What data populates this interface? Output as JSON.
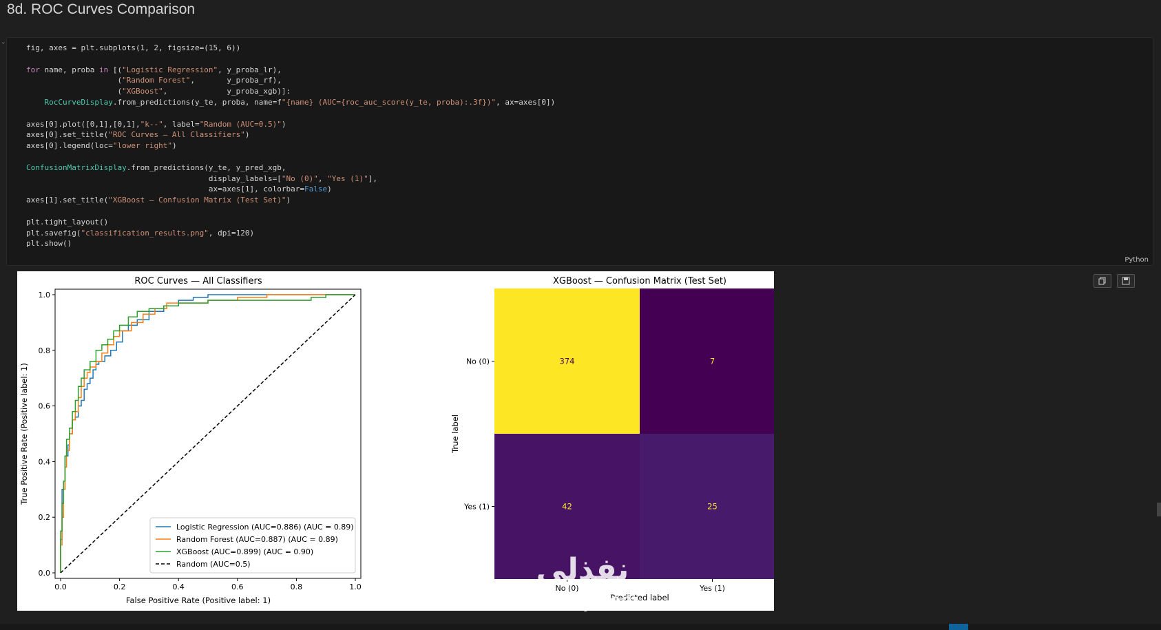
{
  "heading": "8d. ROC Curves Comparison",
  "cell": {
    "language": "Python",
    "code_lines": [
      "fig, axes = plt.subplots(1, 2, figsize=(15, 6))",
      "",
      "for name, proba in [(\"Logistic Regression\", y_proba_lr),",
      "                    (\"Random Forest\",       y_proba_rf),",
      "                    (\"XGBoost\",             y_proba_xgb)]:",
      "    RocCurveDisplay.from_predictions(y_te, proba, name=f\"{name} (AUC={roc_auc_score(y_te, proba):.3f})\", ax=axes[0])",
      "",
      "axes[0].plot([0,1],[0,1],\"k--\", label=\"Random (AUC=0.5)\")",
      "axes[0].set_title(\"ROC Curves — All Classifiers\")",
      "axes[0].legend(loc=\"lower right\")",
      "",
      "ConfusionMatrixDisplay.from_predictions(y_te, y_pred_xgb,",
      "                                        display_labels=[\"No (0)\", \"Yes (1)\"],",
      "                                        ax=axes[1], colorbar=False)",
      "axes[1].set_title(\"XGBoost — Confusion Matrix (Test Set)\")",
      "",
      "plt.tight_layout()",
      "plt.savefig(\"classification_results.png\", dpi=120)",
      "plt.show()"
    ]
  },
  "toolbar": {
    "copy_icon": "copy-icon",
    "save_icon": "save-icon"
  },
  "watermark": {
    "logo": "نفذلي",
    "url": "nafezly.com"
  },
  "chart_data": [
    {
      "type": "line",
      "title": "ROC Curves — All Classifiers",
      "xlabel": "False Positive Rate (Positive label: 1)",
      "ylabel": "True Positive Rate (Positive label: 1)",
      "xlim": [
        0,
        1
      ],
      "ylim": [
        0,
        1
      ],
      "xticks": [
        "0.0",
        "0.2",
        "0.4",
        "0.6",
        "0.8",
        "1.0"
      ],
      "yticks": [
        "0.0",
        "0.2",
        "0.4",
        "0.6",
        "0.8",
        "1.0"
      ],
      "legend_position": "lower right",
      "series": [
        {
          "name": "Logistic Regression (AUC=0.886) (AUC = 0.89)",
          "color": "#1f77b4",
          "dash": false,
          "x": [
            0,
            0,
            0.005,
            0.005,
            0.015,
            0.015,
            0.025,
            0.03,
            0.04,
            0.05,
            0.06,
            0.07,
            0.08,
            0.09,
            0.1,
            0.11,
            0.12,
            0.13,
            0.15,
            0.17,
            0.19,
            0.21,
            0.23,
            0.26,
            0.3,
            0.35,
            0.4,
            0.45,
            0.5,
            0.6,
            0.7,
            0.8,
            0.9,
            1
          ],
          "y": [
            0,
            0.12,
            0.2,
            0.3,
            0.36,
            0.42,
            0.46,
            0.5,
            0.55,
            0.56,
            0.6,
            0.62,
            0.66,
            0.68,
            0.7,
            0.73,
            0.75,
            0.76,
            0.78,
            0.8,
            0.83,
            0.87,
            0.89,
            0.91,
            0.94,
            0.96,
            0.98,
            0.99,
            1,
            1,
            1,
            1,
            1,
            1
          ]
        },
        {
          "name": "Random Forest (AUC=0.887) (AUC = 0.89)",
          "color": "#ff7f0e",
          "dash": false,
          "x": [
            0,
            0,
            0.005,
            0.01,
            0.015,
            0.02,
            0.03,
            0.04,
            0.05,
            0.06,
            0.07,
            0.08,
            0.09,
            0.1,
            0.12,
            0.14,
            0.16,
            0.18,
            0.2,
            0.24,
            0.28,
            0.32,
            0.36,
            0.42,
            0.5,
            0.6,
            0.7,
            0.8,
            0.9,
            1
          ],
          "y": [
            0,
            0.1,
            0.2,
            0.3,
            0.38,
            0.44,
            0.5,
            0.55,
            0.58,
            0.63,
            0.67,
            0.7,
            0.72,
            0.74,
            0.76,
            0.79,
            0.82,
            0.85,
            0.87,
            0.9,
            0.93,
            0.95,
            0.97,
            0.97,
            0.98,
            0.99,
            1,
            1,
            1,
            1
          ]
        },
        {
          "name": "XGBoost (AUC=0.899) (AUC = 0.90)",
          "color": "#2ca02c",
          "dash": false,
          "x": [
            0,
            0,
            0.005,
            0.01,
            0.015,
            0.02,
            0.03,
            0.04,
            0.05,
            0.06,
            0.07,
            0.08,
            0.1,
            0.12,
            0.14,
            0.16,
            0.18,
            0.2,
            0.23,
            0.26,
            0.3,
            0.35,
            0.4,
            0.5,
            0.6,
            0.7,
            0.8,
            0.85,
            0.9,
            1
          ],
          "y": [
            0,
            0.15,
            0.25,
            0.33,
            0.42,
            0.48,
            0.52,
            0.58,
            0.62,
            0.67,
            0.7,
            0.73,
            0.76,
            0.8,
            0.82,
            0.84,
            0.87,
            0.89,
            0.92,
            0.94,
            0.95,
            0.96,
            0.97,
            0.98,
            0.98,
            0.98,
            0.98,
            0.99,
            1,
            1
          ]
        },
        {
          "name": "Random (AUC=0.5)",
          "color": "#000000",
          "dash": true,
          "x": [
            0,
            1
          ],
          "y": [
            0,
            1
          ]
        }
      ]
    },
    {
      "type": "heatmap",
      "title": "XGBoost — Confusion Matrix (Test Set)",
      "xlabel": "Predicted label",
      "ylabel": "True label",
      "row_labels": [
        "No (0)",
        "Yes (1)"
      ],
      "col_labels": [
        "No (0)",
        "Yes (1)"
      ],
      "values": [
        [
          374,
          7
        ],
        [
          42,
          25
        ]
      ],
      "colors": [
        [
          "#fde725",
          "#440154"
        ],
        [
          "#471365",
          "#481a6c"
        ]
      ],
      "text_colors": [
        [
          "#440154",
          "#fde725"
        ],
        [
          "#fde725",
          "#fde725"
        ]
      ]
    }
  ]
}
